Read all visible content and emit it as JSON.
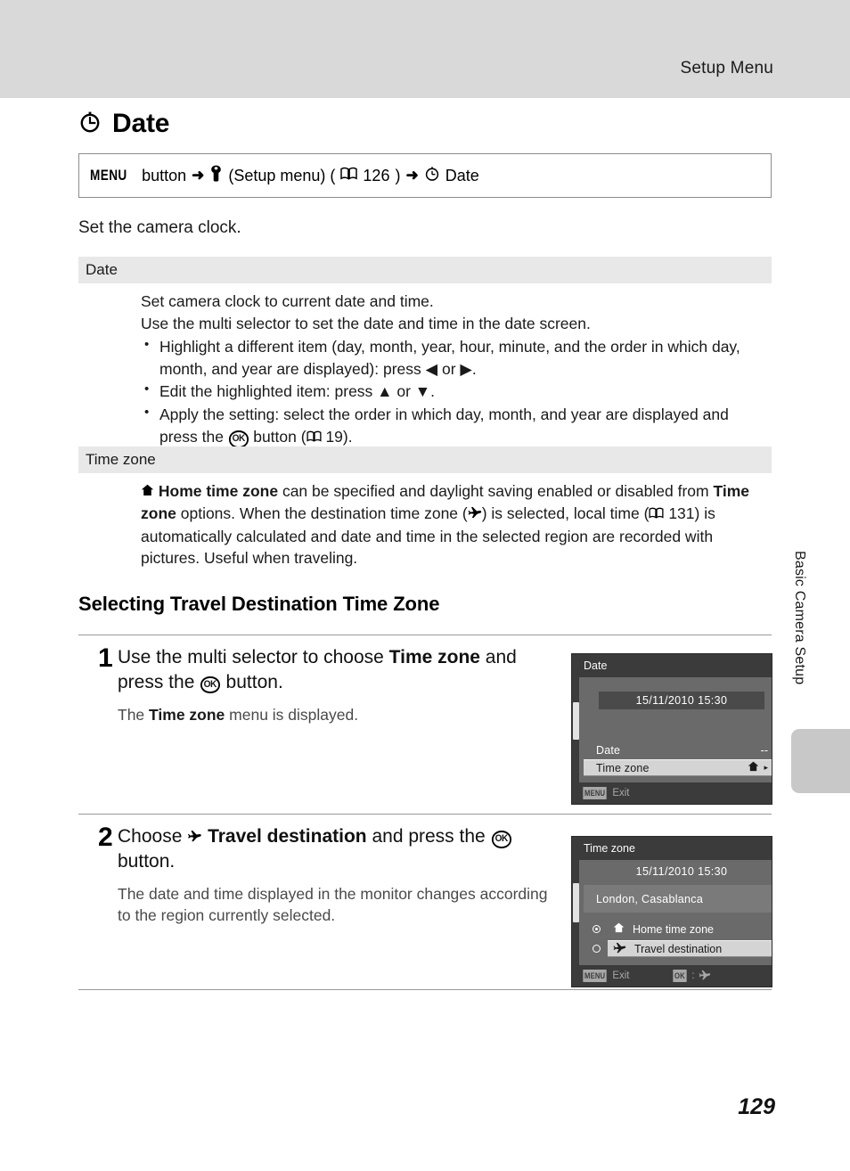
{
  "header": {
    "title": "Setup Menu"
  },
  "page_title": {
    "icon": "clock-icon",
    "text": "Date"
  },
  "breadcrumb": {
    "menu_word": "MENU",
    "button_word": "button",
    "arrow1": "➜",
    "wrench_icon": "🔧",
    "setup_menu_text": "(Setup menu) (",
    "book_icon": "📖",
    "page_ref_1": "126",
    "close_paren": ")",
    "arrow2": "➜",
    "clock_icon": "⊕",
    "date_text": "Date"
  },
  "intro": "Set the camera clock.",
  "sections": [
    {
      "heading": "Date",
      "lines": [
        "Set camera clock to current date and time.",
        "Use the multi selector to set the date and time in the date screen."
      ],
      "bullets": [
        {
          "prefix": "Highlight a different item (day, month, year, hour, minute, and the order in which day, month, and year are displayed): press ",
          "left_arrow": "◀",
          "or_word": " or ",
          "right_arrow": "▶",
          "suffix": "."
        },
        {
          "prefix": "Edit the highlighted item: press ",
          "up_arrow": "▲",
          "or_word": " or ",
          "down_arrow": "▼",
          "suffix": "."
        },
        {
          "prefix": "Apply the setting: select the order in which day, month, and year are displayed and press the ",
          "ok_badge": "OK",
          "mid": " button (",
          "book_icon": "📖",
          "page_ref": "19",
          "suffix": ")."
        }
      ]
    },
    {
      "heading": "Time zone",
      "home_icon": "⌂",
      "home_bold": "Home time zone",
      "text_1": " can be specified and daylight saving enabled or disabled from ",
      "tz_bold": "Time zone",
      "text_2": " options. When the destination time zone (",
      "plane_icon": "✈",
      "text_3": ") is selected, local time (",
      "book_icon": "📖",
      "page_ref": "131",
      "text_4": ") is automatically calculated and date and time in the selected region are recorded with pictures. Useful when traveling."
    }
  ],
  "sub_heading": "Selecting Travel Destination Time Zone",
  "steps": [
    {
      "number": "1",
      "main_prefix": "Use the multi selector to choose ",
      "main_bold": "Time zone",
      "main_mid": " and press the ",
      "ok_badge": "OK",
      "main_suffix": " button.",
      "sub_prefix": "The ",
      "sub_bold": "Time zone",
      "sub_suffix": " menu is displayed."
    },
    {
      "number": "2",
      "main_prefix": "Choose ",
      "plane_icon": "✈",
      "main_bold": "Travel destination",
      "main_mid": " and press the ",
      "ok_badge": "OK",
      "main_suffix": " button.",
      "sub_text": "The date and time displayed in the monitor changes according to the region currently selected."
    }
  ],
  "camera_screens": [
    {
      "title": "Date",
      "datetime": "15/11/2010 15:30",
      "rows": [
        {
          "label": "Date",
          "value": "--"
        },
        {
          "label": "Time zone",
          "value": "⌂",
          "arrow": "▸",
          "highlighted": true
        }
      ],
      "footer": {
        "menu_key": "MENU",
        "menu_label": "Exit"
      }
    },
    {
      "title": "Time zone",
      "datetime": "15/11/2010 15:30",
      "city": "London, Casablanca",
      "options": [
        {
          "selected": true,
          "icon": "⌂",
          "label": "Home time zone",
          "highlighted": false
        },
        {
          "selected": false,
          "icon": "✈",
          "label": "Travel destination",
          "highlighted": true
        }
      ],
      "footer": {
        "menu_key": "MENU",
        "menu_label": "Exit",
        "ok_key": "OK",
        "ok_label": ":",
        "ok_icon": "✈"
      }
    }
  ],
  "side_tab": {
    "label": "Basic Camera Setup"
  },
  "page_number": "129"
}
